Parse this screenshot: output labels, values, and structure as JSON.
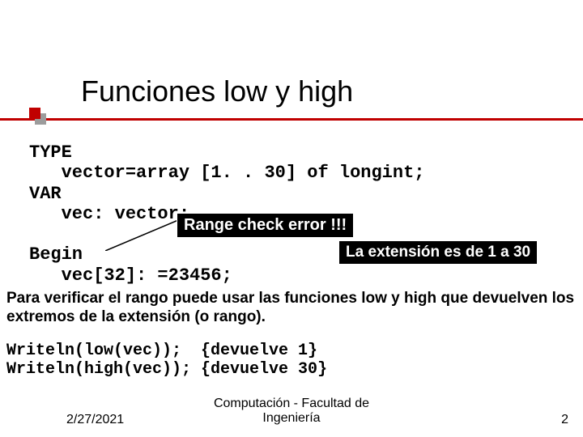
{
  "title": "Funciones low y high",
  "code": {
    "l1": "TYPE",
    "l2": "   vector=array [1. . 30] of longint;",
    "l3": "VAR",
    "l4": "   vec: vector;",
    "l5": "",
    "l6": "Begin",
    "l7": "   vec[32]: =23456;"
  },
  "callouts": {
    "range": "Range check error !!!",
    "extension": "La extensión es de 1 a 30"
  },
  "paragraph": "Para verificar el rango puede usar las funciones low y high que devuelven los extremos de la extensión (o rango).",
  "code2": {
    "l1": "Writeln(low(vec));  {devuelve 1}",
    "l2": "Writeln(high(vec)); {devuelve 30}"
  },
  "footer": {
    "date": "2/27/2021",
    "center1": "Computación - Facultad de",
    "center2": "Ingeniería",
    "page": "2"
  }
}
